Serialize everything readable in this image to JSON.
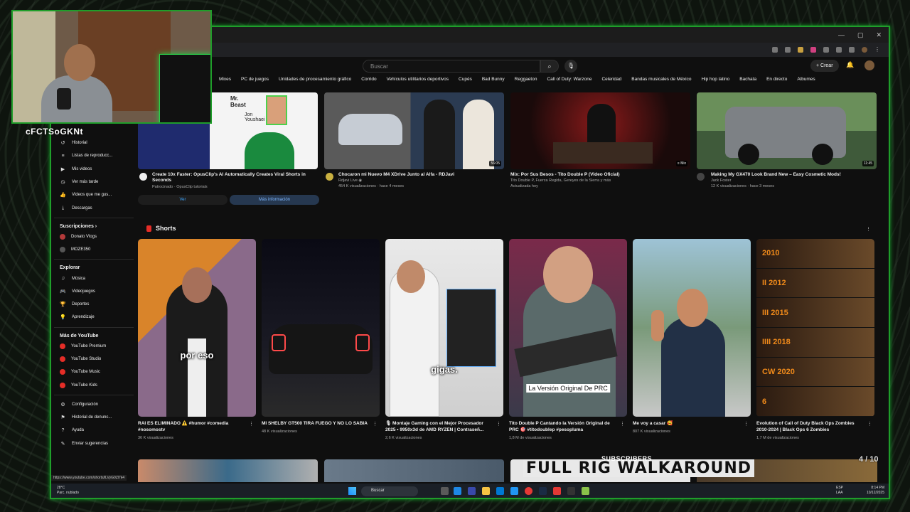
{
  "browser": {
    "window_controls": [
      "—",
      "▢",
      "✕"
    ]
  },
  "masthead": {
    "search_placeholder": "Buscar",
    "search_icon": "⌕",
    "mic_icon": "🎙",
    "create_label": "+ Crear",
    "bell_icon": "🔔"
  },
  "chips": [
    "Mixes",
    "PC de juegos",
    "Unidades de procesamiento gráfico",
    "Corrido",
    "Vehículos utilitarios deportivos",
    "Cupés",
    "Bad Bunny",
    "Reggaeton",
    "Call of Duty: Warzone",
    "Celeridad",
    "Bandas musicales de México",
    "Hip hop latino",
    "Bachata",
    "En directo",
    "Álbumes"
  ],
  "sidebar": {
    "you_items": [
      {
        "icon": "↺",
        "label": "Historial"
      },
      {
        "icon": "≡",
        "label": "Listas de reproducc..."
      },
      {
        "icon": "▶",
        "label": "Mis videos"
      },
      {
        "icon": "◷",
        "label": "Ver más tarde"
      },
      {
        "icon": "👍",
        "label": "Videos que me gus..."
      },
      {
        "icon": "⤓",
        "label": "Descargas"
      }
    ],
    "subs_header": "Suscripciones ›",
    "subs": [
      {
        "label": "Donato Vlogs",
        "color": "#b33a3a"
      },
      {
        "label": "MOZE350",
        "color": "#555555"
      }
    ],
    "explore_header": "Explorar",
    "explore": [
      {
        "icon": "♫",
        "label": "Música"
      },
      {
        "icon": "🎮",
        "label": "Videojuegos"
      },
      {
        "icon": "🏆",
        "label": "Deportes"
      },
      {
        "icon": "💡",
        "label": "Aprendizaje"
      }
    ],
    "more_header": "Más de YouTube",
    "more": [
      {
        "label": "YouTube Premium"
      },
      {
        "label": "YouTube Studio"
      },
      {
        "label": "YouTube Music"
      },
      {
        "label": "YouTube Kids"
      }
    ],
    "settings": [
      {
        "icon": "⚙",
        "label": "Configuración"
      },
      {
        "icon": "⚑",
        "label": "Historial de denunc..."
      },
      {
        "icon": "?",
        "label": "Ayuda"
      },
      {
        "icon": "✎",
        "label": "Enviar sugerencias"
      }
    ]
  },
  "top_videos": [
    {
      "title": "Create 10x Faster: OpusClip's AI Automatically Creates Viral Shorts in Seconds",
      "meta1": "Patrocinado · OpusClip tutorials",
      "meta2": "",
      "duration": "",
      "thumb_text": "Mr. Beast",
      "thumb_text2": "Jon Youshaei"
    },
    {
      "title": "Chocaron mi Nuevo M4 XDrive Junto al Alfa - RDJavi",
      "meta1": "Rdjavi Live ◉",
      "meta2": "454 K visualizaciones · hace 4 meses",
      "duration": "56:05"
    },
    {
      "title": "Mix: Por Sus Besos - Tito Double P (Video Oficial)",
      "meta1": "Tito Double P, Fuerza Regida, Gereyes de la Sierra y más",
      "meta2": "Actualizada hoy",
      "duration": "≡ Mix"
    },
    {
      "title": "Making My GX470 Look Brand New – Easy Cosmetic Mods!",
      "meta1": "Jack Foster",
      "meta2": "12 K visualizaciones · hace 3 meses",
      "duration": "11:45"
    }
  ],
  "ad_buttons": {
    "ver": "Ver",
    "mas_info": "Más información"
  },
  "shorts": {
    "header": "Shorts",
    "items": [
      {
        "caption": "por eso",
        "title": "RAI ES ELIMINADO ⚠️ #humor #comedia #nosomostv",
        "views": "36 K visualizaciones"
      },
      {
        "caption": "",
        "title": "MI SHELBY GT500 TIRA FUEGO Y NO LO SABIA",
        "views": "48 K visualizaciones"
      },
      {
        "caption": "gigas.",
        "title": "🎙 Montaje Gaming con el Mejor Procesador 2025 • 9950x3d de AMD RYZEN | Contraseñ...",
        "views": "2,6 K visualizaciones"
      },
      {
        "caption": "La Versión Original De PRC",
        "title": "Tito Double P Cantando la Versión Original de PRC 🎯 #titodoublep #pesopluma",
        "views": "1,8 M de visualizaciones"
      },
      {
        "caption": "",
        "title": "Me voy a casar 🥰",
        "views": "807 K visualizaciones"
      },
      {
        "caption": "",
        "title": "Evolution of Call of Duty Black Ops Zombies 2010-2024 | Black Ops 6 Zombies",
        "views": "1,7 M de visualizaciones"
      }
    ],
    "cod_years": [
      "2010",
      "II 2012",
      "III 2015",
      "IIII 2018",
      "CW 2020",
      "6"
    ]
  },
  "taskbar": {
    "search": "Buscar",
    "tray_lang": "ESP LAA",
    "time": "8:14 PM",
    "date": "10/12/2025",
    "weather": "28°C",
    "weather_desc": "Parc. nublado"
  },
  "status_url": "https://www.youtube.com/shorts/lLVyG0Zl7k4",
  "overlay": {
    "streamer_name": "cFCTSoGKNt",
    "counter": "4 / 10",
    "subscribers": "SUBSCRIBERS",
    "rig": "FULL RIG WALKAROUND"
  },
  "colors": {
    "accent_green": "#1f9e2a",
    "yt_red": "#e52d27",
    "bg": "#0f0f0f"
  }
}
